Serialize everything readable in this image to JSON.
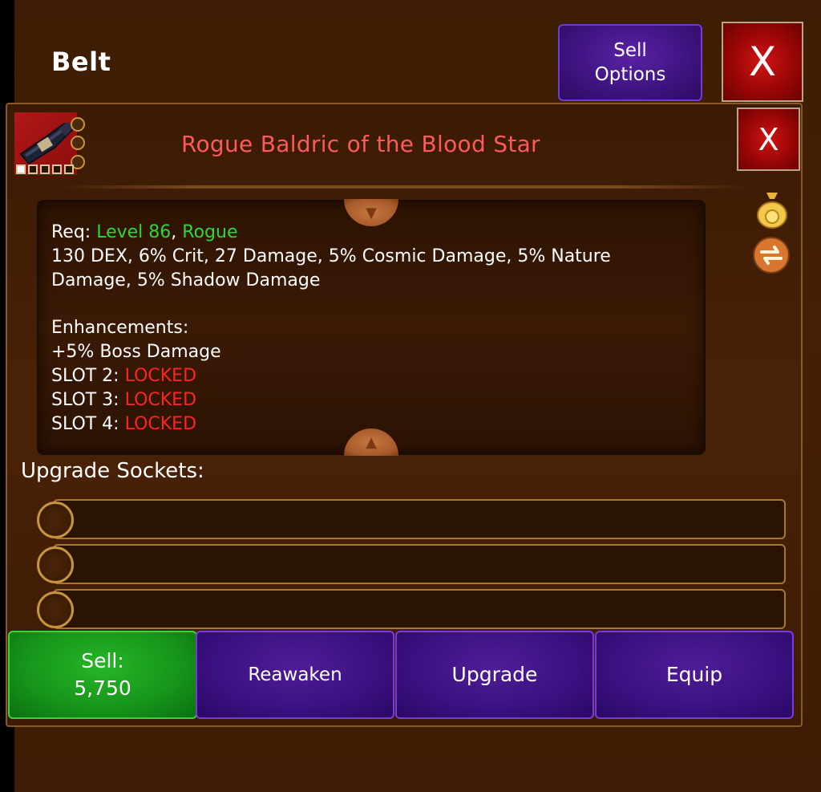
{
  "header": {
    "title": "Belt",
    "sell_options_line1": "Sell",
    "sell_options_line2": "Options",
    "close_label": "X"
  },
  "item": {
    "name": "Rogue Baldric of the Blood Star",
    "close_label": "X",
    "req_label": "Req:",
    "req_level": "Level 86",
    "req_sep": ",",
    "req_class": "Rogue",
    "stats_line": "130 DEX, 6% Crit, 27 Damage, 5% Cosmic Damage, 5% Nature Damage, 5% Shadow Damage",
    "enhancements_label": "Enhancements:",
    "enhancement_1": "+5% Boss Damage",
    "slots": [
      {
        "label": "SLOT 2:",
        "status": "LOCKED"
      },
      {
        "label": "SLOT 3:",
        "status": "LOCKED"
      },
      {
        "label": "SLOT 4:",
        "status": "LOCKED"
      }
    ]
  },
  "upgrade_sockets": {
    "title": "Upgrade Sockets:"
  },
  "buttons": {
    "sell_label": "Sell:",
    "sell_price": "5,750",
    "reawaken": "Reawaken",
    "upgrade": "Upgrade",
    "equip": "Equip"
  },
  "colors": {
    "item_name": "#ff5a5a",
    "requirement": "#2fd82f",
    "locked": "#ff2424",
    "sell_button": "#16941a",
    "action_button": "#3a1180"
  },
  "icons": [
    "belt-item-icon",
    "gold-bag-icon",
    "swap-icon",
    "scroll-down-icon",
    "scroll-up-icon"
  ]
}
